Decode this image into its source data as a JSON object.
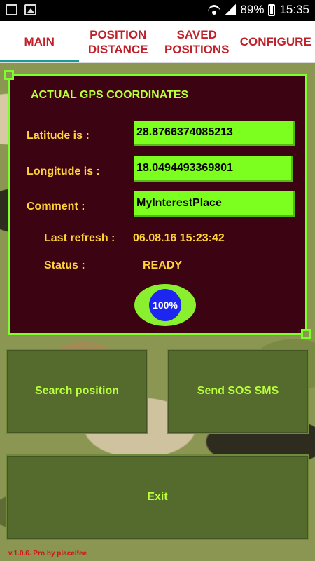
{
  "status_bar": {
    "battery": "89%",
    "time": "15:35"
  },
  "tabs": [
    {
      "label_line1": "MAIN",
      "label_line2": ""
    },
    {
      "label_line1": "POSITION",
      "label_line2": "DISTANCE"
    },
    {
      "label_line1": "SAVED",
      "label_line2": "POSITIONS"
    },
    {
      "label_line1": "CONFIGURE",
      "label_line2": ""
    }
  ],
  "panel": {
    "title": "ACTUAL GPS COORDINATES",
    "latitude_label": "Latitude is :",
    "latitude_value": "28.8766374085213",
    "longitude_label": "Longitude is :",
    "longitude_value": "18.0494493369801",
    "comment_label": "Comment :",
    "comment_value": "MyInterestPlace",
    "last_refresh_label": "Last refresh :",
    "last_refresh_value": "06.08.16 15:23:42",
    "status_label": "Status :",
    "status_value": "READY",
    "progress": "100%"
  },
  "buttons": {
    "search": "Search position",
    "sos": "Send SOS SMS",
    "exit": "Exit"
  },
  "footer": {
    "version": "v.1.0.6. Pro by placeIfee"
  },
  "colors": {
    "accent_green": "#7cff2b",
    "panel_bg": "#3c0312",
    "label_yellow": "#ffd23a",
    "tab_red": "#c0202a"
  }
}
